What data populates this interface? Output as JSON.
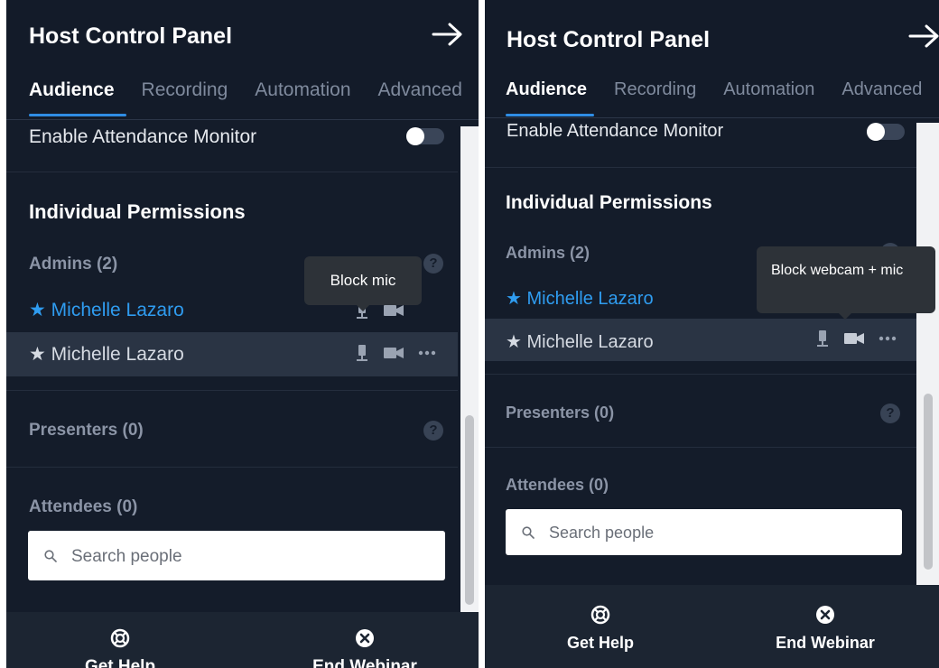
{
  "left": {
    "panel_title": "Host Control Panel",
    "tabs": [
      {
        "label": "Audience",
        "active": true
      },
      {
        "label": "Recording",
        "active": false
      },
      {
        "label": "Automation",
        "active": false
      },
      {
        "label": "Advanced",
        "active": false
      }
    ],
    "attendance_label": "Enable Attendance Monitor",
    "permissions_title": "Individual Permissions",
    "admins_label": "Admins (2)",
    "admins": [
      {
        "name": "Michelle Lazaro",
        "highlight": true
      },
      {
        "name": "Michelle Lazaro",
        "highlight": false
      }
    ],
    "tooltip": "Block mic",
    "presenters_label": "Presenters (0)",
    "attendees_label": "Attendees (0)",
    "search_placeholder": "Search people",
    "help_glyph": "?",
    "star_glyph": "★",
    "footer": {
      "help_label": "Get Help",
      "end_label": "End Webinar"
    }
  },
  "right": {
    "panel_title": "Host Control Panel",
    "tabs": [
      {
        "label": "Audience",
        "active": true
      },
      {
        "label": "Recording",
        "active": false
      },
      {
        "label": "Automation",
        "active": false
      },
      {
        "label": "Advanced",
        "active": false
      }
    ],
    "attendance_label": "Enable Attendance Monitor",
    "permissions_title": "Individual Permissions",
    "admins_label": "Admins (2)",
    "admins": [
      {
        "name": "Michelle Lazaro",
        "highlight": true
      },
      {
        "name": "Michelle Lazaro",
        "highlight": false
      }
    ],
    "tooltip": "Block webcam + mic",
    "presenters_label": "Presenters (0)",
    "attendees_label": "Attendees (0)",
    "search_placeholder": "Search people",
    "help_glyph": "?",
    "star_glyph": "★",
    "footer": {
      "help_label": "Get Help",
      "end_label": "End Webinar"
    }
  },
  "colors": {
    "panel_bg": "#141c2a",
    "accent_blue": "#2f9cf0",
    "tab_underline": "#2f8de4",
    "row_highlight": "#2a3444",
    "tooltip_bg": "#2d3238"
  },
  "icons": [
    "arrow-right-icon",
    "mic-icon",
    "video-icon",
    "more-icon",
    "help-icon",
    "search-icon",
    "lifebuoy-icon",
    "close-circle-icon"
  ]
}
